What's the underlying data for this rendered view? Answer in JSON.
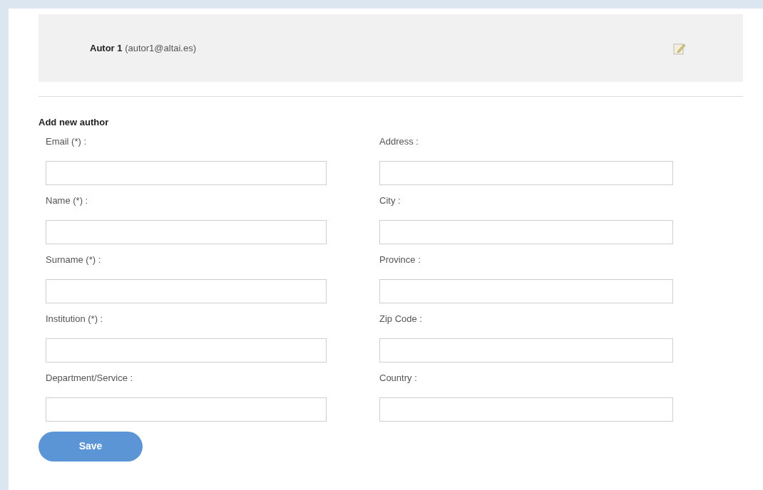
{
  "author": {
    "name": "Autor 1",
    "email": "(autor1@altai.es)"
  },
  "form_title": "Add new author",
  "left_fields": [
    {
      "label": "Email (*) :"
    },
    {
      "label": "Name (*) :"
    },
    {
      "label": "Surname (*) :"
    },
    {
      "label": "Institution (*) :"
    },
    {
      "label": "Department/Service :"
    }
  ],
  "right_fields": [
    {
      "label": "Address :"
    },
    {
      "label": "City :"
    },
    {
      "label": "Province :"
    },
    {
      "label": "Zip Code :"
    },
    {
      "label": "Country :"
    }
  ],
  "save_button": "Save"
}
